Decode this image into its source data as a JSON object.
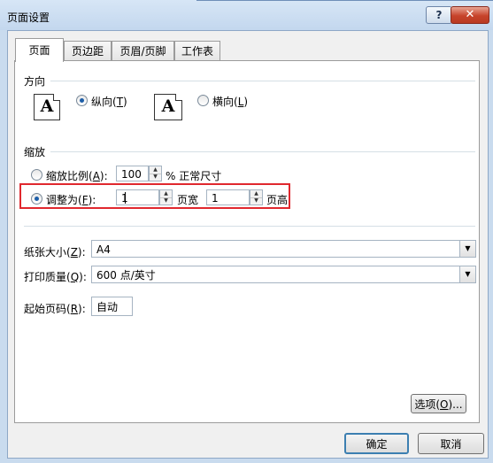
{
  "window": {
    "title": "页面设置",
    "help_label": "?",
    "close_label": "✕"
  },
  "tabs": [
    {
      "label": "页面"
    },
    {
      "label": "页边距"
    },
    {
      "label": "页眉/页脚"
    },
    {
      "label": "工作表"
    }
  ],
  "orientation": {
    "section_label": "方向",
    "icon_letter": "A",
    "portrait": {
      "prefix": "纵向(",
      "key": "T",
      "suffix": ")",
      "selected": true
    },
    "landscape": {
      "prefix": "横向(",
      "key": "L",
      "suffix": ")",
      "selected": false
    }
  },
  "scaling": {
    "section_label": "缩放",
    "adjust_scale": {
      "prefix": "缩放比例(",
      "key": "A",
      "suffix": "):",
      "value": "100",
      "unit": "% 正常尺寸",
      "selected": false
    },
    "fit_to": {
      "prefix": "调整为(",
      "key": "F",
      "suffix": "):",
      "pages_wide": "1",
      "wide_label": "页宽",
      "pages_tall": "1",
      "tall_label": "页高",
      "selected": true
    }
  },
  "paper_size": {
    "prefix": "纸张大小(",
    "key": "Z",
    "suffix": "):",
    "value": "A4"
  },
  "print_quality": {
    "prefix": "打印质量(",
    "key": "Q",
    "suffix": "):",
    "value": "600 点/英寸"
  },
  "first_page_number": {
    "prefix": "起始页码(",
    "key": "R",
    "suffix": "):",
    "value": "自动"
  },
  "options_button": {
    "prefix": "选项(",
    "key": "O",
    "suffix": ")..."
  },
  "ok_button": "确定",
  "cancel_button": "取消"
}
